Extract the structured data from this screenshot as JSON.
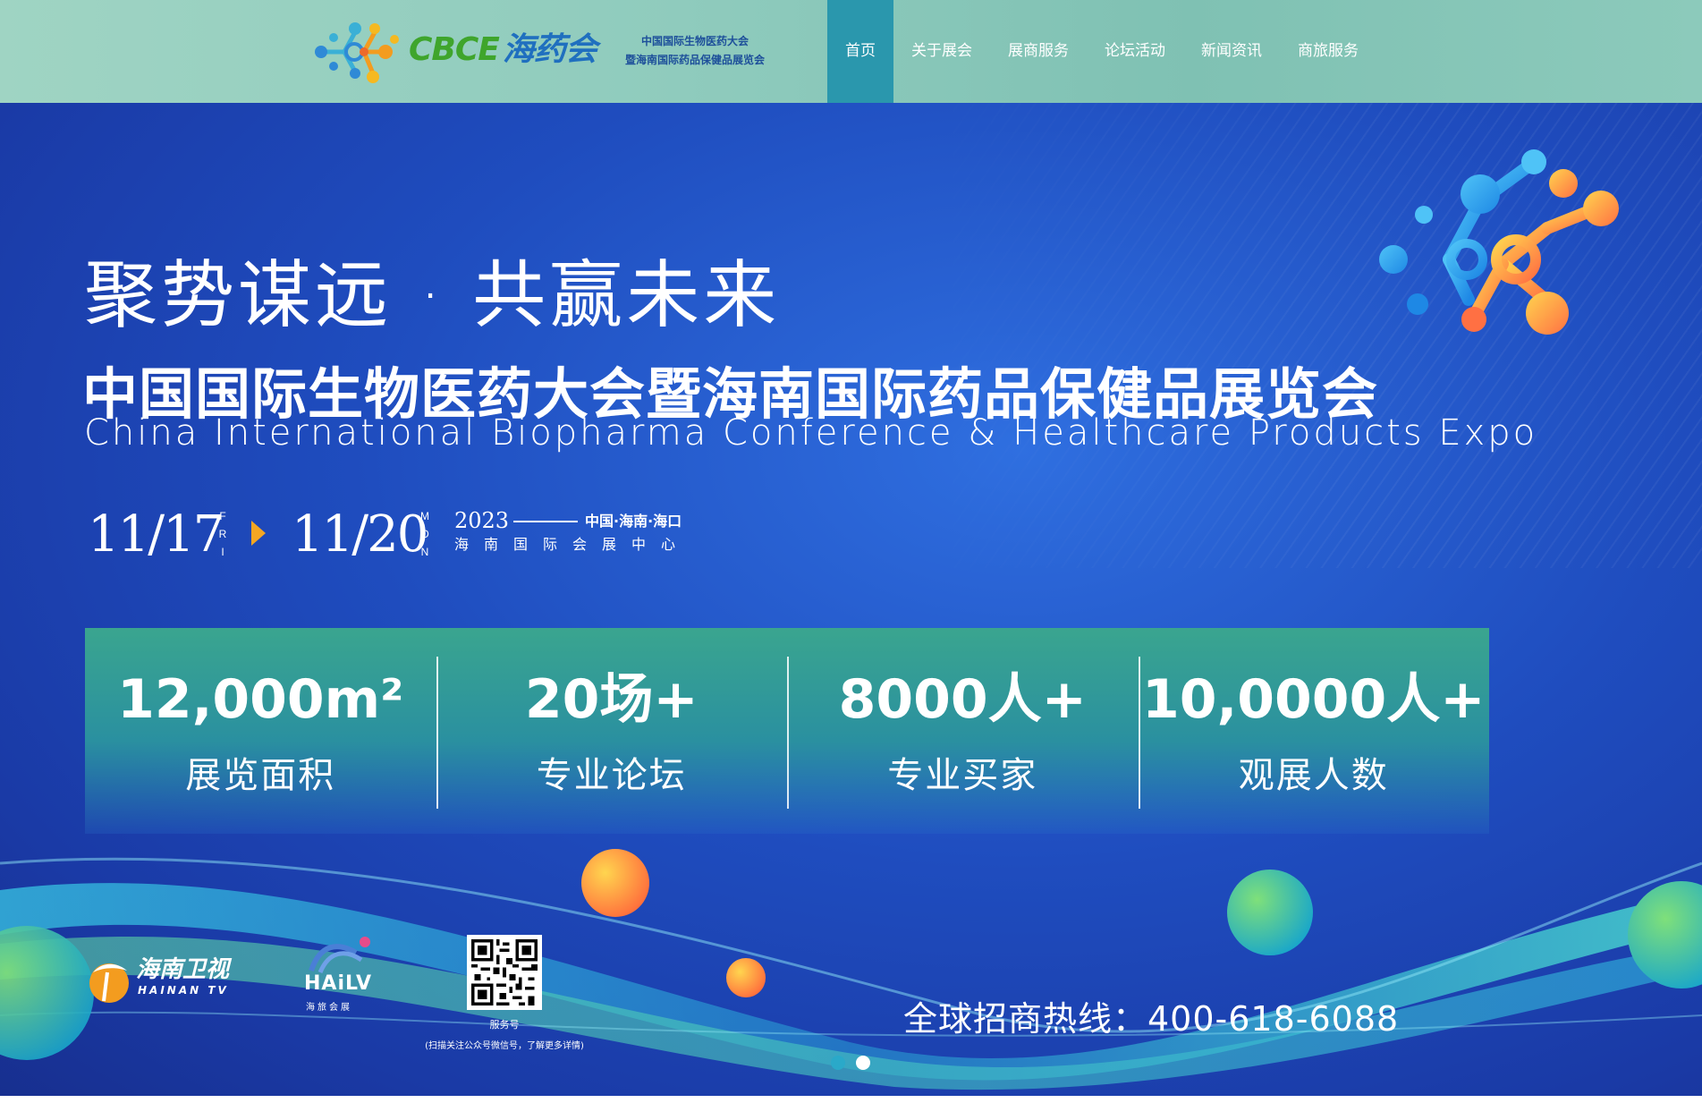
{
  "header": {
    "logo": {
      "text_latin": "CBCE",
      "text_cn": "海药会",
      "sub_line1": "中国国际生物医药大会",
      "sub_line2": "暨海南国际药品保健品展览会"
    },
    "nav": [
      {
        "label": "首页",
        "active": true
      },
      {
        "label": "关于展会",
        "active": false
      },
      {
        "label": "展商服务",
        "active": false
      },
      {
        "label": "论坛活动",
        "active": false
      },
      {
        "label": "新闻资讯",
        "active": false
      },
      {
        "label": "商旅服务",
        "active": false
      }
    ]
  },
  "banner": {
    "slogan": "聚势谋远 · 共赢未来",
    "title_cn": "中国国际生物医药大会暨海南国际药品保健品展览会",
    "title_en": "China International Biopharma Conference & Healthcare Products Expo",
    "date": {
      "start": "11/17",
      "start_dow": "FRI",
      "end": "11/20",
      "end_dow": "MON",
      "year": "2023",
      "location_line1": "中国·海南·海口",
      "location_line2": "海南国际会展中心"
    },
    "stats": [
      {
        "value": "12,000m²",
        "label": "展览面积"
      },
      {
        "value": "20场+",
        "label": "专业论坛"
      },
      {
        "value": "8000人+",
        "label": "专业买家"
      },
      {
        "value": "10,0000人+",
        "label": "观展人数"
      }
    ],
    "partners": {
      "hainan_tv": {
        "name": "海南卫视",
        "sub": "HAINAN TV"
      },
      "hailv": {
        "name": "HAiLV",
        "sub": "海旅会展"
      }
    },
    "qr": {
      "label": "服务号",
      "note": "(扫描关注公众号微信号，了解更多详情)"
    },
    "hotline": "全球招商热线：400-618-6088",
    "carousel": {
      "slides": 2,
      "current": 2
    }
  },
  "colors": {
    "header_bg": "#8fcbbd",
    "nav_active": "#2a97ad",
    "banner_blue": "#1f4dbf",
    "stats_green": "#3aa58f",
    "accent_orange": "#f4a623"
  }
}
